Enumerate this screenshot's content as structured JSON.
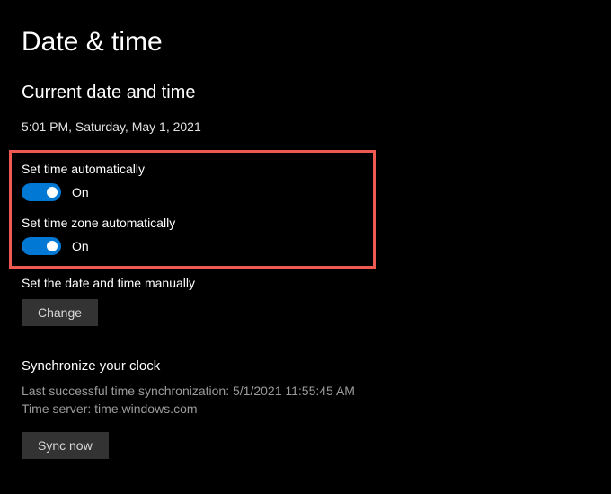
{
  "page": {
    "title": "Date & time"
  },
  "current": {
    "heading": "Current date and time",
    "value": "5:01 PM, Saturday, May 1, 2021"
  },
  "autoTime": {
    "label": "Set time automatically",
    "state": "On"
  },
  "autoZone": {
    "label": "Set time zone automatically",
    "state": "On"
  },
  "manual": {
    "label": "Set the date and time manually",
    "button": "Change"
  },
  "sync": {
    "heading": "Synchronize your clock",
    "lastSync": "Last successful time synchronization: 5/1/2021 11:55:45 AM",
    "server": "Time server: time.windows.com",
    "button": "Sync now"
  }
}
